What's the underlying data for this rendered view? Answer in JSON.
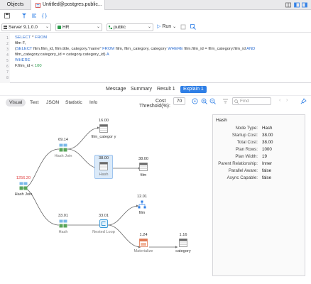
{
  "tabs": {
    "objects": "Objects",
    "query": "Untitled@postgres.public..."
  },
  "toolbar": {
    "server": "Server 9.1.0.0",
    "database": "HR",
    "schema": "public",
    "run": "Run"
  },
  "editor": {
    "line_numbers": [
      "1",
      "2",
      "3",
      "4",
      "5",
      "6",
      "7",
      "8"
    ]
  },
  "result_tabs": {
    "message": "Message",
    "summary": "Summary",
    "result1": "Result 1",
    "explain1": "Explain 1"
  },
  "subtabs": {
    "visual": "Visual",
    "text": "Text",
    "json": "JSON",
    "statistic": "Statistic",
    "info": "Info",
    "cost_label": "Cost",
    "cost_value": "70",
    "threshold_label": "Threshold(%):",
    "find_placeholder": "Find"
  },
  "nodes": {
    "hashjoin_root": {
      "cost": "1256.20",
      "name": "Hash Join"
    },
    "hashjoin_mid": {
      "cost": "69.14",
      "name": "Hash Join"
    },
    "film_category": {
      "cost": "16.00",
      "name": "film_categor y"
    },
    "hash_sel": {
      "cost": "38.00",
      "name": "Hash"
    },
    "film_a": {
      "cost": "38.00",
      "name": "film"
    },
    "hash_low": {
      "cost": "33.01",
      "name": "Hash"
    },
    "nested_loop": {
      "cost": "33.01",
      "name": "Nested Loop"
    },
    "film_b": {
      "cost": "12.01",
      "name": "film"
    },
    "materialize": {
      "cost": "1.24",
      "name": "Materialize"
    },
    "category": {
      "cost": "1.16",
      "name": "category"
    }
  },
  "properties": {
    "title": "Hash",
    "rows": [
      {
        "key": "Node Type:",
        "value": "Hash"
      },
      {
        "key": "Startup Cost:",
        "value": "38.00"
      },
      {
        "key": "Total Cost:",
        "value": "38.00"
      },
      {
        "key": "Plan Rows:",
        "value": "1000"
      },
      {
        "key": "Plan Width:",
        "value": "19"
      },
      {
        "key": "Parent Relationship:",
        "value": "Inner"
      },
      {
        "key": "Parallel Aware:",
        "value": "false"
      },
      {
        "key": "Async Capable:",
        "value": "false"
      }
    ]
  },
  "colors": {
    "accent": "#2f7fe6",
    "keyword": "#2f6fd1",
    "number": "#2a9d4b",
    "highlight_cost": "#e04040"
  }
}
